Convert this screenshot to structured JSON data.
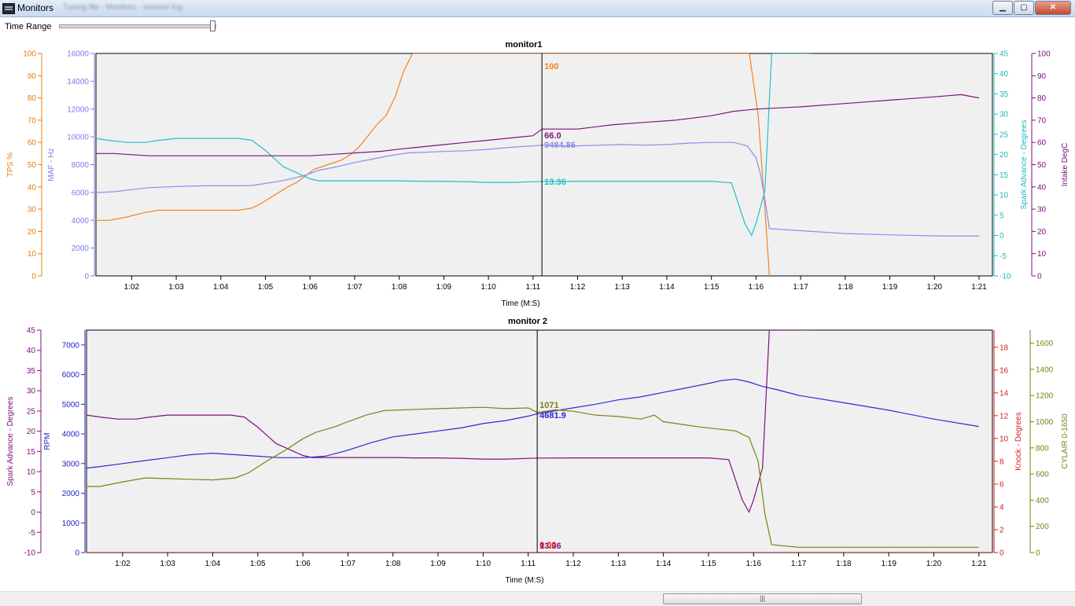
{
  "window": {
    "title": "Monitors",
    "subtitle": "Tuning file - Monitors - session log",
    "min_label": "▁",
    "max_label": "▢",
    "close_label": "✕"
  },
  "toolbar": {
    "time_range_label": "Time Range",
    "time_range_position": 0.985
  },
  "scrollbar": {
    "grip_label": "|||",
    "thumb_start": 0.617,
    "thumb_extent": 0.183
  },
  "chart_data": [
    {
      "type": "line",
      "title": "monitor1",
      "xlabel": "Time (M:S)",
      "xlim": [
        61.2,
        81.3
      ],
      "x_ticks": [
        62,
        63,
        64,
        65,
        66,
        67,
        68,
        69,
        70,
        71,
        72,
        73,
        74,
        75,
        76,
        77,
        78,
        79,
        80,
        81
      ],
      "x_tick_labels": [
        "1:02",
        "1:03",
        "1:04",
        "1:05",
        "1:06",
        "1:07",
        "1:08",
        "1:09",
        "1:10",
        "1:11",
        "1:12",
        "1:13",
        "1:14",
        "1:15",
        "1:16",
        "1:17",
        "1:18",
        "1:19",
        "1:20",
        "1:21"
      ],
      "cursor_x": 71.2,
      "grid": false,
      "axes": [
        {
          "id": "tps",
          "label": "TPS %",
          "side": "left",
          "order": 0,
          "min": 0,
          "max": 100,
          "ticks": [
            0,
            10,
            20,
            30,
            40,
            50,
            60,
            70,
            80,
            90,
            100
          ],
          "color": "#e87d12"
        },
        {
          "id": "maf",
          "label": "MAF - Hz",
          "side": "left",
          "order": 1,
          "min": 0,
          "max": 16000,
          "ticks": [
            0,
            2000,
            4000,
            6000,
            8000,
            10000,
            12000,
            14000,
            16000
          ],
          "color": "#7b7be6"
        },
        {
          "id": "spark",
          "label": "Spark Advance - Degrees",
          "side": "right",
          "order": 0,
          "min": -10,
          "max": 45,
          "ticks": [
            -10,
            -5,
            0,
            5,
            10,
            15,
            20,
            25,
            30,
            35,
            40,
            45
          ],
          "color": "#1fb8bd"
        },
        {
          "id": "intake",
          "label": "Intake DegC",
          "side": "right",
          "order": 1,
          "min": 0,
          "max": 100,
          "ticks": [
            0,
            10,
            20,
            30,
            40,
            50,
            60,
            70,
            80,
            90,
            100
          ],
          "color": "#7a107a"
        }
      ],
      "series": [
        {
          "axis": "tps",
          "color": "#f08321",
          "cursor_value": "100",
          "x": [
            61.2,
            61.5,
            61.9,
            62.3,
            62.6,
            63.0,
            63.5,
            64.0,
            64.4,
            64.7,
            64.9,
            65.1,
            65.3,
            65.5,
            65.7,
            65.9,
            66.1,
            66.4,
            66.7,
            66.9,
            67.1,
            67.3,
            67.5,
            67.7,
            67.9,
            68.1,
            68.3,
            69.0,
            70.0,
            71.2,
            72.0,
            73.0,
            74.0,
            75.0,
            75.85,
            76.05,
            76.2,
            76.3
          ],
          "y": [
            25,
            25,
            26.5,
            28.5,
            29.5,
            29.5,
            29.5,
            29.5,
            29.5,
            30.5,
            32.5,
            35,
            37.5,
            40,
            42,
            45,
            48,
            50,
            52,
            54.5,
            58,
            63,
            68,
            72,
            80,
            92,
            100,
            100,
            100,
            100,
            100,
            100,
            100,
            100,
            100,
            72,
            30,
            0
          ]
        },
        {
          "axis": "maf",
          "color": "#8c8cee",
          "cursor_value": "9484.86",
          "x": [
            61.2,
            61.6,
            62.0,
            62.4,
            62.8,
            63.2,
            63.6,
            64.0,
            64.4,
            64.7,
            65.0,
            65.3,
            65.6,
            65.9,
            66.2,
            66.6,
            67.0,
            67.4,
            67.8,
            68.2,
            68.6,
            69.0,
            69.5,
            70.0,
            70.5,
            71.0,
            71.2,
            71.6,
            72.0,
            72.5,
            73.0,
            73.5,
            74.0,
            74.5,
            75.0,
            75.5,
            75.8,
            76.0,
            76.1,
            76.2,
            76.3,
            77.0,
            78.0,
            79.0,
            80.0,
            81.0
          ],
          "y": [
            6000,
            6050,
            6200,
            6350,
            6400,
            6450,
            6480,
            6480,
            6480,
            6500,
            6650,
            6800,
            7000,
            7250,
            7600,
            7850,
            8150,
            8400,
            8650,
            8850,
            8900,
            8950,
            9000,
            9100,
            9250,
            9350,
            9400,
            9350,
            9350,
            9400,
            9450,
            9400,
            9450,
            9550,
            9600,
            9600,
            9350,
            8500,
            7300,
            5500,
            3400,
            3250,
            3050,
            2950,
            2880,
            2860
          ]
        },
        {
          "axis": "spark",
          "color": "#22c0c4",
          "cursor_value": "13.36",
          "x": [
            61.2,
            61.5,
            61.9,
            62.3,
            62.6,
            63.0,
            63.5,
            64.0,
            64.4,
            64.7,
            65.0,
            65.2,
            65.4,
            65.6,
            65.8,
            66.0,
            66.2,
            66.5,
            67.0,
            67.5,
            68.0,
            68.5,
            69.0,
            69.5,
            70.0,
            70.5,
            71.2,
            72.0,
            73.0,
            74.0,
            75.0,
            75.45,
            75.6,
            75.75,
            75.9,
            76.0,
            76.2,
            76.35,
            77.0,
            78.0,
            79.0,
            80.0,
            81.0
          ],
          "y": [
            24,
            23.5,
            23,
            23,
            23.5,
            24,
            24,
            24,
            24,
            23.5,
            21,
            19,
            17,
            16,
            15,
            14,
            13.5,
            13.5,
            13.5,
            13.5,
            13.5,
            13.4,
            13.4,
            13.3,
            13.1,
            13.1,
            13.36,
            13.4,
            13.4,
            13.4,
            13.4,
            13,
            8,
            3,
            0,
            3,
            11,
            45,
            45,
            45.3,
            45.6,
            46.5,
            47.5
          ]
        },
        {
          "axis": "intake",
          "color": "#7e157e",
          "cursor_value": "66.0",
          "x": [
            61.2,
            61.6,
            62.0,
            62.4,
            62.8,
            63.2,
            63.6,
            64.0,
            64.4,
            64.8,
            65.2,
            65.6,
            66.0,
            66.4,
            66.8,
            67.2,
            67.6,
            68.0,
            68.5,
            69.0,
            69.5,
            70.0,
            70.5,
            71.0,
            71.2,
            72.0,
            72.8,
            73.5,
            74.2,
            75.0,
            75.5,
            76.0,
            76.5,
            77.0,
            78.0,
            79.0,
            80.0,
            80.6,
            81.0
          ],
          "y": [
            55,
            55,
            54.5,
            54,
            54,
            54,
            54,
            54,
            54,
            54,
            54,
            54,
            54,
            54.5,
            55,
            55.5,
            56,
            57,
            58,
            59,
            60,
            61,
            62,
            63,
            66,
            66,
            68,
            69,
            70,
            72,
            74,
            75,
            75.5,
            76,
            77.5,
            79,
            80.5,
            81.5,
            80
          ]
        }
      ]
    },
    {
      "type": "line",
      "title": "monitor 2",
      "xlabel": "Time (M:S)",
      "xlim": [
        61.2,
        81.3
      ],
      "x_ticks": [
        62,
        63,
        64,
        65,
        66,
        67,
        68,
        69,
        70,
        71,
        72,
        73,
        74,
        75,
        76,
        77,
        78,
        79,
        80,
        81
      ],
      "x_tick_labels": [
        "1:02",
        "1:03",
        "1:04",
        "1:05",
        "1:06",
        "1:07",
        "1:08",
        "1:09",
        "1:10",
        "1:11",
        "1:12",
        "1:13",
        "1:14",
        "1:15",
        "1:16",
        "1:17",
        "1:18",
        "1:19",
        "1:20",
        "1:21"
      ],
      "cursor_x": 71.2,
      "grid": false,
      "axes": [
        {
          "id": "spark2",
          "label": "Spark Advance - Degrees",
          "side": "left",
          "order": 0,
          "min": -10,
          "max": 45,
          "ticks": [
            -10,
            -5,
            0,
            5,
            10,
            15,
            20,
            25,
            30,
            35,
            40,
            45
          ],
          "color": "#7a107a"
        },
        {
          "id": "rpm",
          "label": "RPM",
          "side": "left",
          "order": 1,
          "min": 0,
          "max": 7500,
          "ticks": [
            0,
            1000,
            2000,
            3000,
            4000,
            5000,
            6000,
            7000
          ],
          "color": "#2424c0"
        },
        {
          "id": "knock",
          "label": "Knock - Degrees",
          "side": "right",
          "order": 0,
          "min": 0,
          "max": 19.5,
          "ticks": [
            0,
            2,
            4,
            6,
            8,
            10,
            12,
            14,
            16,
            18
          ],
          "color": "#d81e1e"
        },
        {
          "id": "cylair",
          "label": "CYLAIR 0-1650",
          "side": "right",
          "order": 1,
          "min": 0,
          "max": 1700,
          "ticks": [
            0,
            200,
            400,
            600,
            800,
            1000,
            1200,
            1400,
            1600
          ],
          "color": "#7f7f16"
        }
      ],
      "series": [
        {
          "axis": "spark2",
          "color": "#800f80",
          "cursor_value": "13.36",
          "x": [
            61.2,
            61.5,
            61.9,
            62.3,
            62.6,
            63.0,
            63.5,
            64.0,
            64.4,
            64.7,
            65.0,
            65.2,
            65.4,
            65.6,
            65.8,
            66.0,
            66.2,
            66.5,
            67.0,
            67.5,
            68.0,
            68.5,
            69.0,
            69.5,
            70.0,
            70.5,
            71.2,
            72.0,
            73.0,
            74.0,
            75.0,
            75.45,
            75.6,
            75.75,
            75.9,
            76.0,
            76.2,
            76.35,
            77.0,
            78.0,
            79.0,
            80.0,
            81.0
          ],
          "y": [
            24,
            23.5,
            23,
            23,
            23.5,
            24,
            24,
            24,
            24,
            23.5,
            21,
            19,
            17,
            16,
            15,
            14,
            13.5,
            13.5,
            13.5,
            13.5,
            13.5,
            13.4,
            13.4,
            13.3,
            13.1,
            13.1,
            13.36,
            13.4,
            13.4,
            13.4,
            13.4,
            13,
            8,
            3,
            0,
            3,
            11,
            45,
            45,
            45.3,
            45.6,
            46.5,
            47.5
          ]
        },
        {
          "axis": "rpm",
          "color": "#2a2ad8",
          "cursor_value": "4681.9",
          "x": [
            61.2,
            61.5,
            62.0,
            62.5,
            63.0,
            63.5,
            64.0,
            64.5,
            65.0,
            65.5,
            66.0,
            66.5,
            67.0,
            67.5,
            68.0,
            68.5,
            69.0,
            69.5,
            70.0,
            70.5,
            71.0,
            71.2,
            71.6,
            72.0,
            72.5,
            73.0,
            73.5,
            74.0,
            74.5,
            75.0,
            75.3,
            75.6,
            75.9,
            76.2,
            76.5,
            77.0,
            78.0,
            79.0,
            80.0,
            81.0
          ],
          "y": [
            2850,
            2900,
            3000,
            3100,
            3200,
            3300,
            3350,
            3300,
            3250,
            3200,
            3200,
            3250,
            3450,
            3700,
            3900,
            4000,
            4100,
            4200,
            4350,
            4450,
            4600,
            4680,
            4780,
            4880,
            5000,
            5150,
            5250,
            5400,
            5550,
            5700,
            5800,
            5850,
            5750,
            5600,
            5500,
            5300,
            5050,
            4800,
            4500,
            4250
          ]
        },
        {
          "axis": "knock",
          "color": "#d81e1e",
          "cursor_value": "0.00",
          "x": [
            61.2,
            81.3
          ],
          "y": [
            0,
            0
          ]
        },
        {
          "axis": "cylair",
          "color": "#7f7f16",
          "cursor_value": "1071",
          "x": [
            61.2,
            61.5,
            62.0,
            62.5,
            63.0,
            63.5,
            64.0,
            64.5,
            64.8,
            65.2,
            65.6,
            66.0,
            66.3,
            66.7,
            67.0,
            67.4,
            67.8,
            68.2,
            68.6,
            69.0,
            69.5,
            70.0,
            70.5,
            71.0,
            71.2,
            71.6,
            72.0,
            72.5,
            73.0,
            73.5,
            73.8,
            74.0,
            74.4,
            74.8,
            75.2,
            75.6,
            75.9,
            76.1,
            76.25,
            76.4,
            77.0,
            78.0,
            79.0,
            80.0,
            81.0
          ],
          "y": [
            505,
            505,
            540,
            570,
            565,
            560,
            555,
            570,
            610,
            700,
            780,
            870,
            920,
            960,
            1000,
            1050,
            1085,
            1090,
            1095,
            1100,
            1105,
            1110,
            1100,
            1105,
            1071,
            1090,
            1080,
            1050,
            1040,
            1020,
            1050,
            1000,
            980,
            960,
            945,
            930,
            880,
            700,
            300,
            60,
            40,
            40,
            40,
            40,
            40
          ]
        }
      ]
    }
  ]
}
